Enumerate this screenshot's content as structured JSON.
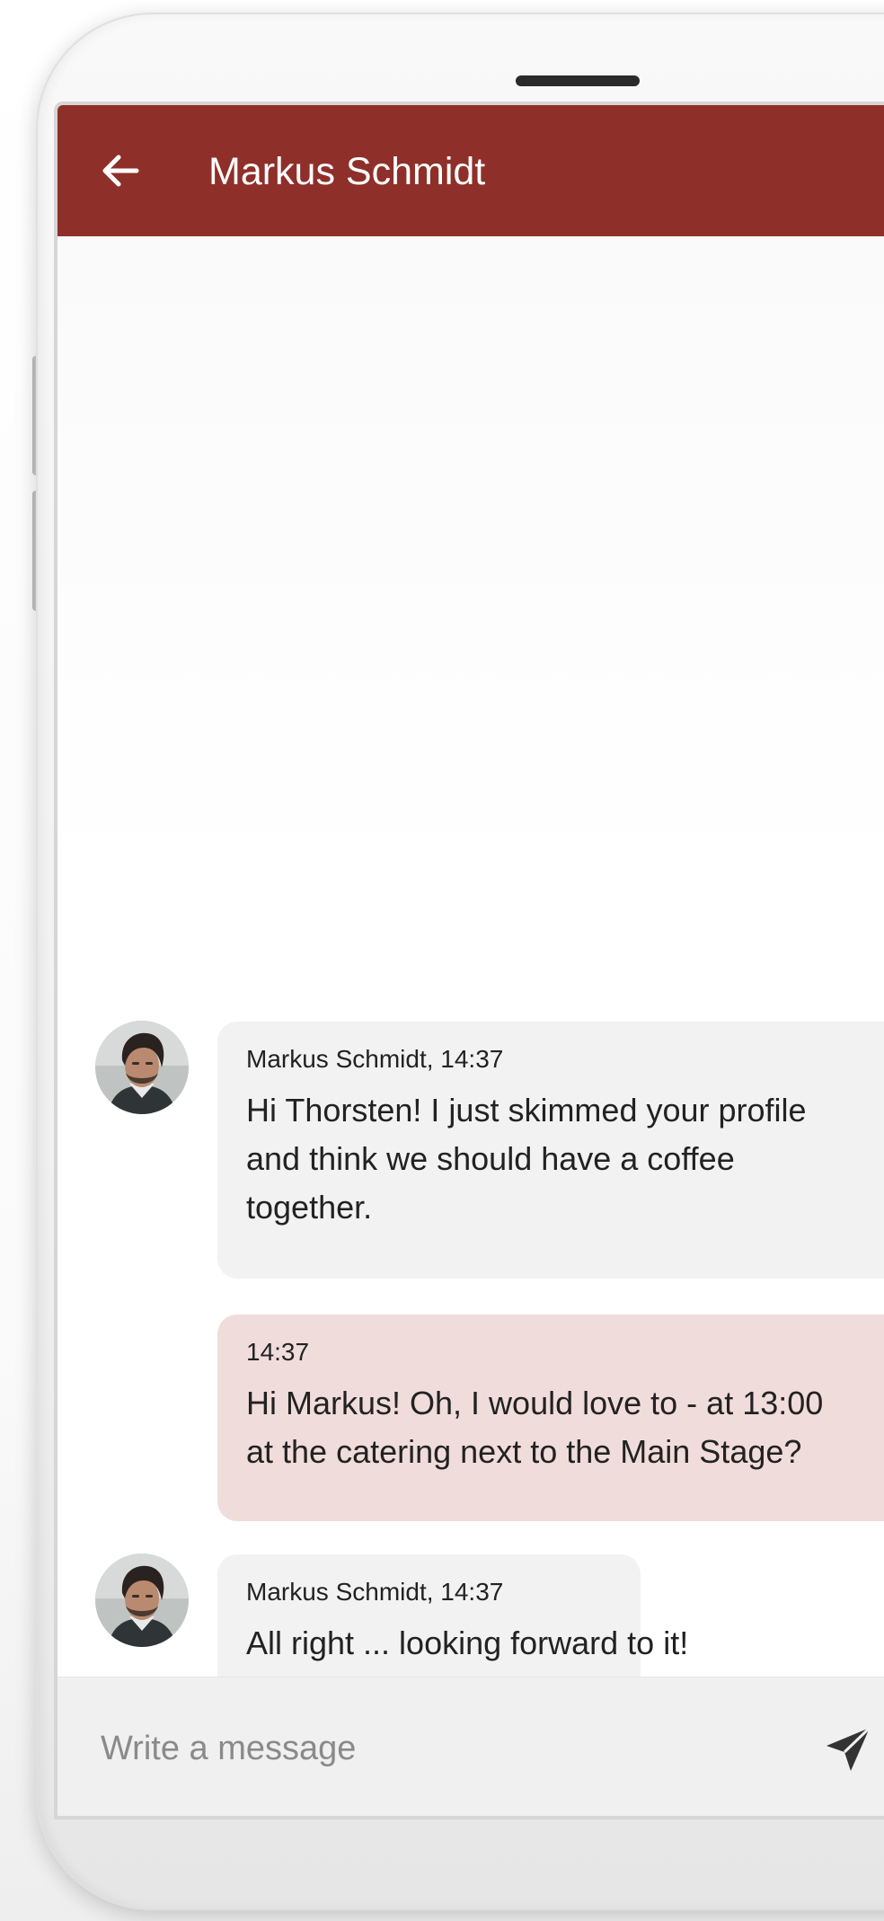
{
  "header": {
    "title": "Markus Schmidt",
    "back_icon": "arrow-left-icon",
    "background_color": "#8f2f29"
  },
  "messages": [
    {
      "direction": "incoming",
      "meta": "Markus Schmidt, 14:37",
      "lines": [
        "Hi Thorsten! I just skimmed your profile",
        "and think we should have a coffee",
        "together."
      ]
    },
    {
      "direction": "outgoing",
      "meta": "14:37",
      "lines": [
        "Hi Markus! Oh, I would love to - at 13:00",
        "at the catering next to the Main Stage?"
      ]
    },
    {
      "direction": "incoming",
      "meta": "Markus Schmidt, 14:37",
      "lines": [
        "All right ... looking forward to it!"
      ]
    }
  ],
  "composer": {
    "placeholder": "Write a message",
    "send_icon": "send-paper-plane-icon"
  },
  "colors": {
    "incoming_bubble": "#f2f2f2",
    "outgoing_bubble": "#f1dcdc"
  }
}
